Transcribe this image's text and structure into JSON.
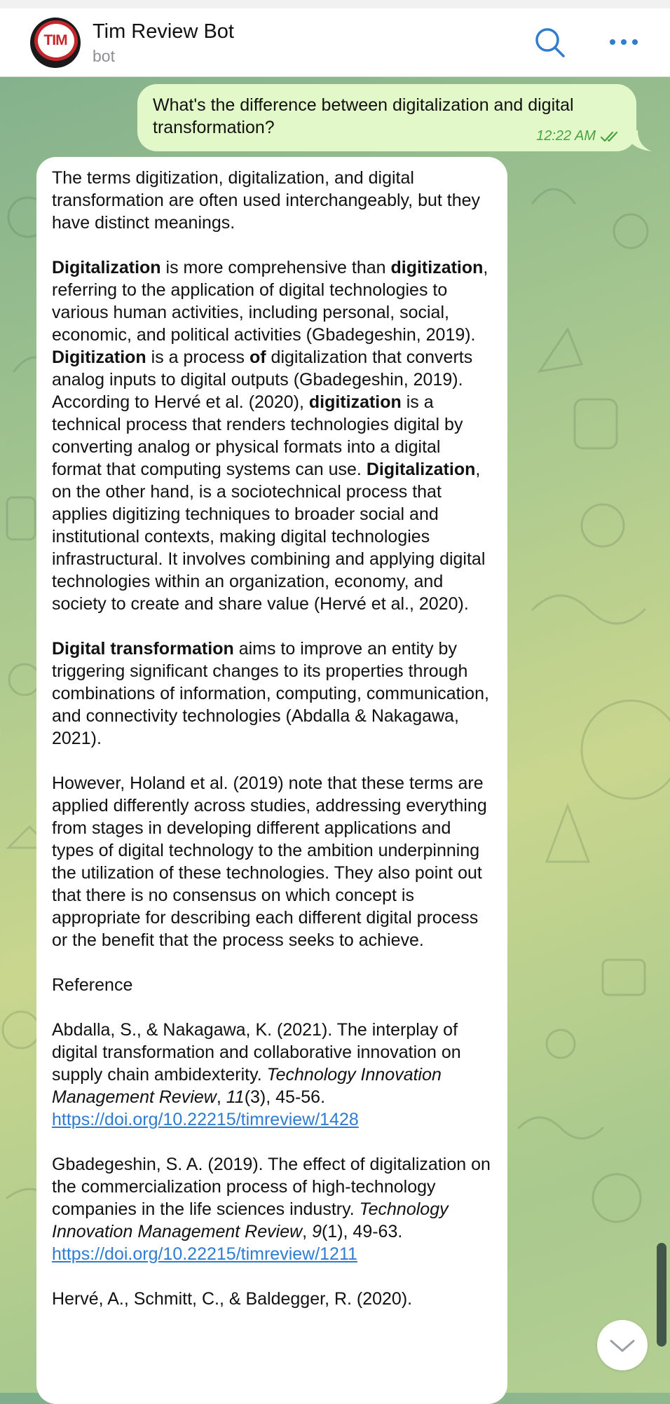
{
  "header": {
    "avatar_text": "TIM",
    "title": "Tim Review Bot",
    "subtitle": "bot",
    "search_icon": "search-icon",
    "more_icon": "more-icon"
  },
  "outgoing": {
    "text": "What's the difference between digitalization and digital transformation?",
    "time": "12:22 AM",
    "status_icon": "double-check-icon"
  },
  "incoming": {
    "p1": "The terms digitization, digitalization, and digital transformation are often used interchangeably, but they have distinct meanings.",
    "p2": {
      "t1": "Digitalization",
      "t2": " is more comprehensive than ",
      "t3": "digitization",
      "t4": ", referring to the application of digital technologies to various human activities, including personal, social, economic, and political activities (Gbadegeshin, 2019). ",
      "t5": "Digitization",
      "t6": " is a process ",
      "t7": "of",
      "t8": " digitalization that converts analog inputs to digital outputs (Gbadegeshin, 2019). According to Hervé et al. (2020), ",
      "t9": "digitization",
      "t10": " is a technical process that renders technologies digital by converting analog or physical formats into a digital format that computing systems can use. ",
      "t11": "Digitalization",
      "t12": ", on the other hand, is a sociotechnical process that applies digitizing techniques to broader social and institutional contexts, making digital technologies infrastructural. It involves combining and applying digital technologies within an organization, economy, and society to create and share value (Hervé et al., 2020)."
    },
    "p3": {
      "t1": "Digital transformation",
      "t2": " aims to improve an entity by triggering significant changes to its properties through combinations of information, computing, communication, and connectivity technologies (Abdalla & Nakagawa, 2021)."
    },
    "p4": "However, Holand et al. (2019) note that these terms are applied differently across studies, addressing everything from stages in developing different applications and types of digital technology to the ambition underpinning the utilization of these technologies. They also point out that there is no consensus on which concept is appropriate for describing each different digital process or the benefit that the process seeks to achieve.",
    "ref_heading": "Reference",
    "ref1": {
      "t1": "Abdalla, S., & Nakagawa, K. (2021). The interplay of digital transformation and collaborative innovation on supply chain ambidexterity. ",
      "t2": "Technology Innovation Management Review",
      "t3": ", ",
      "t4": "11",
      "t5": "(3), 45-56. ",
      "link": "https://doi.org/10.22215/timreview/1428"
    },
    "ref2": {
      "t1": "Gbadegeshin, S. A. (2019). The effect of digitalization on the commercialization process of high-technology companies in the life sciences industry. ",
      "t2": "Technology Innovation Management Review",
      "t3": ", ",
      "t4": "9",
      "t5": "(1), 49-63. ",
      "link": "https://doi.org/10.22215/timreview/1211"
    },
    "ref3_partial": "Hervé, A., Schmitt, C., & Baldegger, R. (2020)."
  },
  "scroll_down_icon": "chevron-down-icon",
  "colors": {
    "accent": "#2f7cd1",
    "outgoing_bubble": "#e3f8c9",
    "read_check": "#46a340",
    "brand_red": "#c3272b"
  }
}
